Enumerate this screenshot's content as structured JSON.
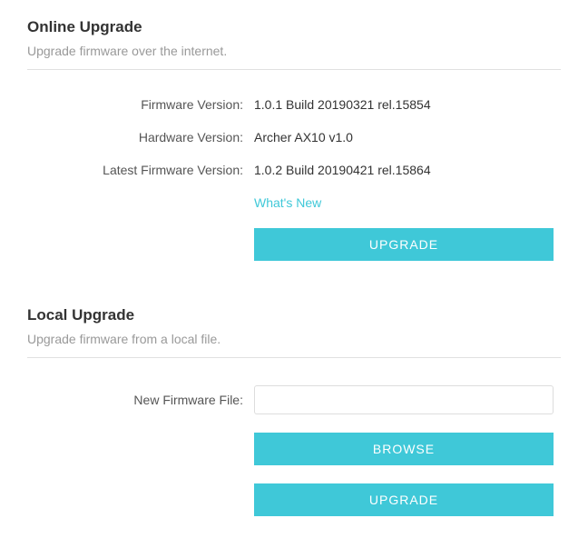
{
  "online": {
    "title": "Online Upgrade",
    "subtitle": "Upgrade firmware over the internet.",
    "firmware_version_label": "Firmware Version:",
    "firmware_version_value": "1.0.1 Build 20190321 rel.15854",
    "hardware_version_label": "Hardware Version:",
    "hardware_version_value": "Archer AX10 v1.0",
    "latest_firmware_label": "Latest Firmware Version:",
    "latest_firmware_value": "1.0.2 Build 20190421 rel.15864",
    "whats_new_link": "What's New",
    "upgrade_button": "UPGRADE"
  },
  "local": {
    "title": "Local Upgrade",
    "subtitle": "Upgrade firmware from a local file.",
    "new_firmware_label": "New Firmware File:",
    "new_firmware_value": "",
    "browse_button": "BROWSE",
    "upgrade_button": "UPGRADE"
  }
}
